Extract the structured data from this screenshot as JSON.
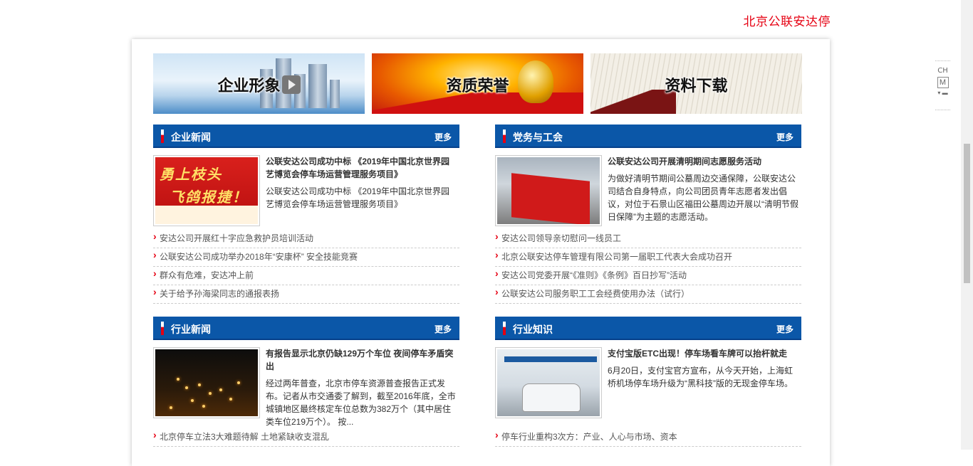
{
  "brand": "北京公联安达停",
  "banners": [
    {
      "label": "企业形象",
      "icon": "play-icon"
    },
    {
      "label": "资质荣誉"
    },
    {
      "label": "资料下载"
    }
  ],
  "sections": {
    "company_news": {
      "title": "企业新闻",
      "more": "更多",
      "feature": {
        "title": "公联安达公司成功中标 《2019年中国北京世界园艺博览会停车场运营管理服务项目》",
        "desc": "公联安达公司成功中标 《2019年中国北京世界园艺博览会停车场运营管理服务项目》",
        "image_text_1": "勇上枝头",
        "image_text_2": "飞鸽报捷！"
      },
      "links": [
        "安达公司开展红十字应急救护员培训活动",
        "公联安达公司成功举办2018年“安康杯” 安全技能竞赛",
        "群众有危难，安达冲上前",
        "关于给予孙海梁同志的通报表扬"
      ]
    },
    "party": {
      "title": "党务与工会",
      "more": "更多",
      "feature": {
        "title": "公联安达公司开展清明期间志愿服务活动",
        "desc": "为做好清明节期间公墓周边交通保障，公联安达公司结合自身特点，向公司团员青年志愿者发出倡议，对位于石景山区福田公墓周边开展以“清明节假日保障”为主题的志愿活动。"
      },
      "links": [
        "安达公司领导亲切慰问一线员工",
        "北京公联安达停车管理有限公司第一届职工代表大会成功召开",
        "安达公司党委开展“《准则》《条例》百日抄写”活动",
        "公联安达公司服务职工工会经费使用办法（试行）"
      ]
    },
    "industry_news": {
      "title": "行业新闻",
      "more": "更多",
      "feature": {
        "title": "有报告显示北京仍缺129万个车位 夜间停车矛盾突出",
        "desc": "经过两年普查，北京市停车资源普查报告正式发布。记者从市交通委了解到，截至2016年底，全市城镇地区最终核定车位总数为382万个（其中居住类车位219万个）。 按..."
      },
      "links": [
        "北京停车立法3大难题待解 土地紧缺收支混乱"
      ]
    },
    "industry_knowledge": {
      "title": "行业知识",
      "more": "更多",
      "feature": {
        "title": "支付宝版ETC出现！停车场看车牌可以抬杆就走",
        "desc": "6月20日，支付宝官方宣布，从今天开始，上海虹桥机场停车场升级为“黑科技”版的无现金停车场。"
      },
      "links": [
        "停车行业重构3次方：产业、人心与市场、资本"
      ]
    }
  },
  "side_tool": {
    "lang": "CH",
    "mode": "M",
    "more": "▾ ▬"
  },
  "colors": {
    "accent_red": "#e60012",
    "header_blue": "#0b57a8"
  }
}
